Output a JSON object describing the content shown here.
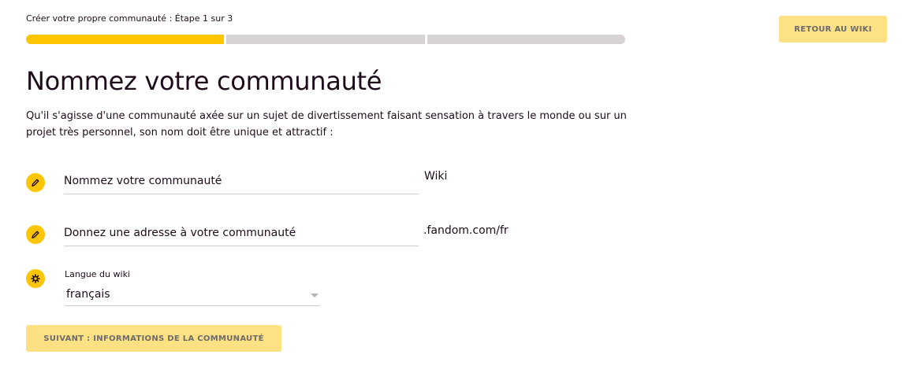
{
  "header": {
    "step_label": "Créer votre propre communauté : Étape 1 sur 3",
    "progress": {
      "total_steps": 3,
      "current_step": 1
    },
    "back_button": "RETOUR AU WIKI"
  },
  "main": {
    "title": "Nommez votre communauté",
    "intro": "Qu'il s'agisse d'une communauté axée sur un sujet de divertissement faisant sensation à travers le monde ou sur un projet très personnel, son nom doit être unique et attractif :",
    "name_field": {
      "value": "",
      "placeholder": "Nommez votre communauté",
      "suffix": "Wiki",
      "icon": "pencil-icon"
    },
    "address_field": {
      "value": "",
      "placeholder": "Donnez une adresse à votre communauté",
      "suffix": ".fandom.com/fr",
      "icon": "pencil-icon"
    },
    "language": {
      "label": "Langue du wiki",
      "selected": "français",
      "icon": "gear-icon"
    },
    "next_button": "SUIVANT : INFORMATIONS DE LA COMMUNAUTÉ"
  },
  "colors": {
    "accent": "#fec600",
    "accent_light": "#fee182",
    "track": "#d6d2d6",
    "text": "#1e0c1b"
  }
}
